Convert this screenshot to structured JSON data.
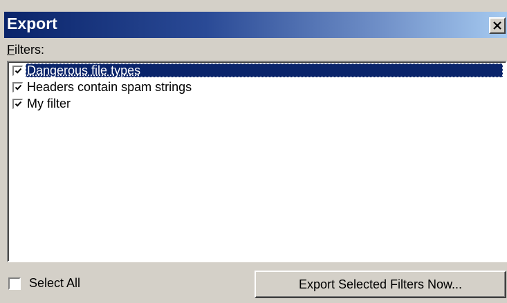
{
  "window": {
    "title": "Export"
  },
  "filters": {
    "label": "Filters:",
    "items": [
      {
        "label": "Dangerous file types",
        "checked": true,
        "selected": true
      },
      {
        "label": "Headers contain spam strings",
        "checked": true,
        "selected": false
      },
      {
        "label": "My filter",
        "checked": true,
        "selected": false
      }
    ]
  },
  "footer": {
    "select_all_label": "Select All",
    "select_all_checked": false,
    "export_button_label": "Export Selected Filters Now..."
  },
  "colors": {
    "titlebar_start": "#0a246a",
    "titlebar_end": "#a6caf0",
    "selection": "#0a246a",
    "face": "#d4d0c8"
  }
}
